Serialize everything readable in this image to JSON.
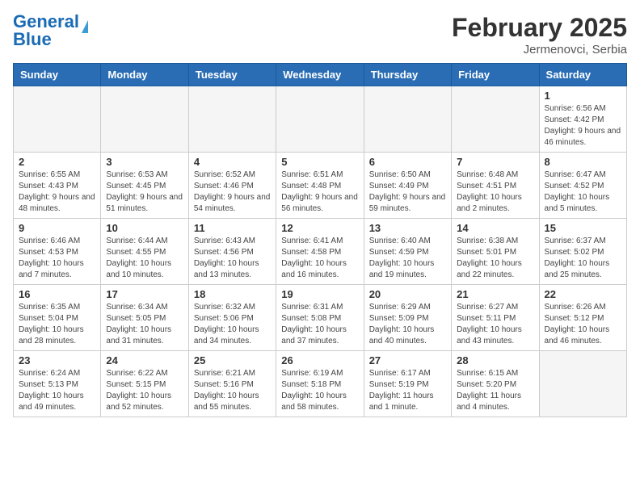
{
  "header": {
    "logo_general": "General",
    "logo_blue": "Blue",
    "month_year": "February 2025",
    "location": "Jermenovci, Serbia"
  },
  "weekdays": [
    "Sunday",
    "Monday",
    "Tuesday",
    "Wednesday",
    "Thursday",
    "Friday",
    "Saturday"
  ],
  "weeks": [
    [
      {
        "day": "",
        "info": ""
      },
      {
        "day": "",
        "info": ""
      },
      {
        "day": "",
        "info": ""
      },
      {
        "day": "",
        "info": ""
      },
      {
        "day": "",
        "info": ""
      },
      {
        "day": "",
        "info": ""
      },
      {
        "day": "1",
        "info": "Sunrise: 6:56 AM\nSunset: 4:42 PM\nDaylight: 9 hours and 46 minutes."
      }
    ],
    [
      {
        "day": "2",
        "info": "Sunrise: 6:55 AM\nSunset: 4:43 PM\nDaylight: 9 hours and 48 minutes."
      },
      {
        "day": "3",
        "info": "Sunrise: 6:53 AM\nSunset: 4:45 PM\nDaylight: 9 hours and 51 minutes."
      },
      {
        "day": "4",
        "info": "Sunrise: 6:52 AM\nSunset: 4:46 PM\nDaylight: 9 hours and 54 minutes."
      },
      {
        "day": "5",
        "info": "Sunrise: 6:51 AM\nSunset: 4:48 PM\nDaylight: 9 hours and 56 minutes."
      },
      {
        "day": "6",
        "info": "Sunrise: 6:50 AM\nSunset: 4:49 PM\nDaylight: 9 hours and 59 minutes."
      },
      {
        "day": "7",
        "info": "Sunrise: 6:48 AM\nSunset: 4:51 PM\nDaylight: 10 hours and 2 minutes."
      },
      {
        "day": "8",
        "info": "Sunrise: 6:47 AM\nSunset: 4:52 PM\nDaylight: 10 hours and 5 minutes."
      }
    ],
    [
      {
        "day": "9",
        "info": "Sunrise: 6:46 AM\nSunset: 4:53 PM\nDaylight: 10 hours and 7 minutes."
      },
      {
        "day": "10",
        "info": "Sunrise: 6:44 AM\nSunset: 4:55 PM\nDaylight: 10 hours and 10 minutes."
      },
      {
        "day": "11",
        "info": "Sunrise: 6:43 AM\nSunset: 4:56 PM\nDaylight: 10 hours and 13 minutes."
      },
      {
        "day": "12",
        "info": "Sunrise: 6:41 AM\nSunset: 4:58 PM\nDaylight: 10 hours and 16 minutes."
      },
      {
        "day": "13",
        "info": "Sunrise: 6:40 AM\nSunset: 4:59 PM\nDaylight: 10 hours and 19 minutes."
      },
      {
        "day": "14",
        "info": "Sunrise: 6:38 AM\nSunset: 5:01 PM\nDaylight: 10 hours and 22 minutes."
      },
      {
        "day": "15",
        "info": "Sunrise: 6:37 AM\nSunset: 5:02 PM\nDaylight: 10 hours and 25 minutes."
      }
    ],
    [
      {
        "day": "16",
        "info": "Sunrise: 6:35 AM\nSunset: 5:04 PM\nDaylight: 10 hours and 28 minutes."
      },
      {
        "day": "17",
        "info": "Sunrise: 6:34 AM\nSunset: 5:05 PM\nDaylight: 10 hours and 31 minutes."
      },
      {
        "day": "18",
        "info": "Sunrise: 6:32 AM\nSunset: 5:06 PM\nDaylight: 10 hours and 34 minutes."
      },
      {
        "day": "19",
        "info": "Sunrise: 6:31 AM\nSunset: 5:08 PM\nDaylight: 10 hours and 37 minutes."
      },
      {
        "day": "20",
        "info": "Sunrise: 6:29 AM\nSunset: 5:09 PM\nDaylight: 10 hours and 40 minutes."
      },
      {
        "day": "21",
        "info": "Sunrise: 6:27 AM\nSunset: 5:11 PM\nDaylight: 10 hours and 43 minutes."
      },
      {
        "day": "22",
        "info": "Sunrise: 6:26 AM\nSunset: 5:12 PM\nDaylight: 10 hours and 46 minutes."
      }
    ],
    [
      {
        "day": "23",
        "info": "Sunrise: 6:24 AM\nSunset: 5:13 PM\nDaylight: 10 hours and 49 minutes."
      },
      {
        "day": "24",
        "info": "Sunrise: 6:22 AM\nSunset: 5:15 PM\nDaylight: 10 hours and 52 minutes."
      },
      {
        "day": "25",
        "info": "Sunrise: 6:21 AM\nSunset: 5:16 PM\nDaylight: 10 hours and 55 minutes."
      },
      {
        "day": "26",
        "info": "Sunrise: 6:19 AM\nSunset: 5:18 PM\nDaylight: 10 hours and 58 minutes."
      },
      {
        "day": "27",
        "info": "Sunrise: 6:17 AM\nSunset: 5:19 PM\nDaylight: 11 hours and 1 minute."
      },
      {
        "day": "28",
        "info": "Sunrise: 6:15 AM\nSunset: 5:20 PM\nDaylight: 11 hours and 4 minutes."
      },
      {
        "day": "",
        "info": ""
      }
    ]
  ]
}
